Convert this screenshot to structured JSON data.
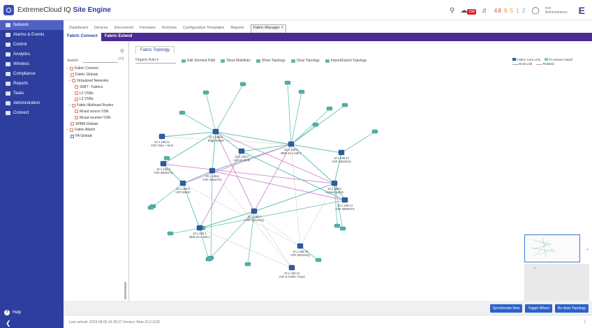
{
  "app": {
    "title_prefix": "ExtremeCloud IQ",
    "title_strong": "Site Engine"
  },
  "header": {
    "notif_badge": "158",
    "alarm_red": "48",
    "alarm_orange": "9",
    "alarm_mid": "5",
    "alarm_gray": "1",
    "alarm_last": "2",
    "user_line1": "root",
    "user_line2": "Administrators"
  },
  "sidebar": {
    "items": [
      {
        "label": "Network"
      },
      {
        "label": "Alarms & Events"
      },
      {
        "label": "Control"
      },
      {
        "label": "Analytics"
      },
      {
        "label": "Wireless"
      },
      {
        "label": "Compliance"
      },
      {
        "label": "Reports"
      },
      {
        "label": "Tasks"
      },
      {
        "label": "Administration"
      },
      {
        "label": "Connect"
      }
    ],
    "help": "Help"
  },
  "tabs": [
    {
      "label": "Dashboard"
    },
    {
      "label": "Devices"
    },
    {
      "label": "Discovered"
    },
    {
      "label": "Firmware"
    },
    {
      "label": "Archives"
    },
    {
      "label": "Configuration Templates"
    },
    {
      "label": "Reports"
    },
    {
      "label": "Fabric Manager"
    }
  ],
  "subtabs": [
    {
      "label": "Fabric Connect"
    },
    {
      "label": "Fabric Extend"
    }
  ],
  "tree": {
    "search_label": "Search",
    "nodes": [
      {
        "label": "Fabric Connect"
      },
      {
        "label": "Fabric Globals"
      },
      {
        "label": "Virtualized Networks"
      },
      {
        "label": "SWIT - Fabrics"
      },
      {
        "label": "L2 VSNs"
      },
      {
        "label": "L3 VSNs"
      },
      {
        "label": "Fabric Multicast Routes"
      },
      {
        "label": "Mcast source VSN"
      },
      {
        "label": "Mcast receiver VSN"
      },
      {
        "label": "SPBM Globals"
      },
      {
        "label": "Fabric Attach"
      },
      {
        "label": "FA Globals"
      }
    ]
  },
  "topology": {
    "tab": "Fabric Topology",
    "layout": "Organic Auto",
    "toolbar": [
      {
        "label": "Edit Shortest Path"
      },
      {
        "label": "Show Multilinks"
      },
      {
        "label": "Show Topology"
      },
      {
        "label": "Clear Topology"
      },
      {
        "label": "Import/Export Topology"
      }
    ],
    "legend": {
      "row1": [
        "Fabric Core Link",
        "FA Server Attach"
      ],
      "row2": [
        "BCB Link",
        "Related"
      ]
    },
    "colors": {
      "fabric": "#66c1b6",
      "related": "#d08bd0",
      "bcb": "#999999",
      "device": "#2f5e9e"
    }
  },
  "nodes": [
    {
      "id": "n1",
      "label1": "10.1.168.6",
      "label2": "Edge switch"
    },
    {
      "id": "n2",
      "label1": "10.1.168.11",
      "label2": "VSP 7254 + 60 B"
    },
    {
      "id": "n3",
      "label1": "10.1.168.3",
      "label2": "Access 15 B"
    },
    {
      "id": "n4",
      "label1": "10.1.168.4",
      "label2": "VSP 4850GTS"
    },
    {
      "id": "n5",
      "label1": "10.1.168.5",
      "label2": "VSP 4850GTS"
    },
    {
      "id": "n6",
      "label1": "10.1.168.9",
      "label2": "VSP 8404C"
    },
    {
      "id": "n7",
      "label1": "10.1.168.2",
      "label2": "BEB 10.1.168.2"
    },
    {
      "id": "n8",
      "label1": "10.1.168.7",
      "label2": "VSP 7254XSQ"
    },
    {
      "id": "n9",
      "label1": "10.1.168.8",
      "label2": "Access switch"
    },
    {
      "id": "n10",
      "label1": "10.1.168.1",
      "label2": "BEB 10.1.168.1"
    },
    {
      "id": "n11",
      "label1": "10.1.168.12",
      "label2": "VSP 4450GSX"
    },
    {
      "id": "n12",
      "label1": "10.1.168.10",
      "label2": "VSP 8284XSQ"
    },
    {
      "id": "n13",
      "label1": "10.1.168.14",
      "label2": "VSP 4850GTS"
    },
    {
      "id": "n14",
      "label1": "10.1.168.13",
      "label2": "VSP & Fabric Cloud"
    }
  ],
  "minimap": {
    "zoom": "+"
  },
  "buttons": [
    {
      "label": "Synchronize Now"
    },
    {
      "label": "Toggle Wheel"
    },
    {
      "label": "Re-draw Topology"
    }
  ],
  "status": {
    "text": "Last refresh: 2023-06-05 14:38:27  Version: Beta 23.2.1135"
  }
}
